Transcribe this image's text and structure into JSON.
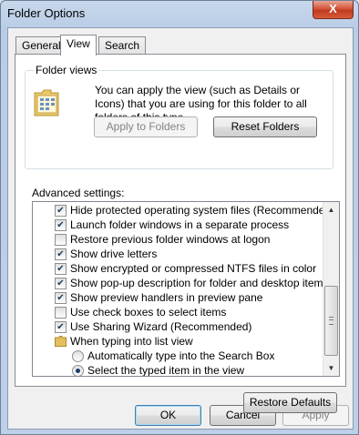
{
  "window": {
    "title": "Folder Options",
    "close_symbol": "X"
  },
  "tabs": [
    {
      "label": "General",
      "active": false
    },
    {
      "label": "View",
      "active": true
    },
    {
      "label": "Search",
      "active": false
    }
  ],
  "folder_views": {
    "legend": "Folder views",
    "description": "You can apply the view (such as Details or Icons) that you are using for this folder to all folders of this type.",
    "apply_button": "Apply to Folders",
    "reset_button": "Reset Folders"
  },
  "advanced": {
    "label": "Advanced settings:",
    "items": [
      {
        "type": "checkbox",
        "checked": true,
        "label": "Hide protected operating system files (Recommended)"
      },
      {
        "type": "checkbox",
        "checked": true,
        "label": "Launch folder windows in a separate process"
      },
      {
        "type": "checkbox",
        "checked": false,
        "label": "Restore previous folder windows at logon"
      },
      {
        "type": "checkbox",
        "checked": true,
        "label": "Show drive letters"
      },
      {
        "type": "checkbox",
        "checked": true,
        "label": "Show encrypted or compressed NTFS files in color"
      },
      {
        "type": "checkbox",
        "checked": true,
        "label": "Show pop-up description for folder and desktop items"
      },
      {
        "type": "checkbox",
        "checked": true,
        "label": "Show preview handlers in preview pane"
      },
      {
        "type": "checkbox",
        "checked": false,
        "label": "Use check boxes to select items"
      },
      {
        "type": "checkbox",
        "checked": true,
        "label": "Use Sharing Wizard (Recommended)"
      },
      {
        "type": "folder",
        "label": "When typing into list view"
      },
      {
        "type": "radio",
        "selected": false,
        "label": "Automatically type into the Search Box"
      },
      {
        "type": "radio",
        "selected": true,
        "label": "Select the typed item in the view"
      }
    ],
    "restore_button": "Restore Defaults"
  },
  "footer": {
    "ok": "OK",
    "cancel": "Cancel",
    "apply": "Apply"
  },
  "colors": {
    "title_bar": "#b9cde6",
    "close_button": "#c8432a",
    "default_button_border": "#3c7fb1"
  }
}
